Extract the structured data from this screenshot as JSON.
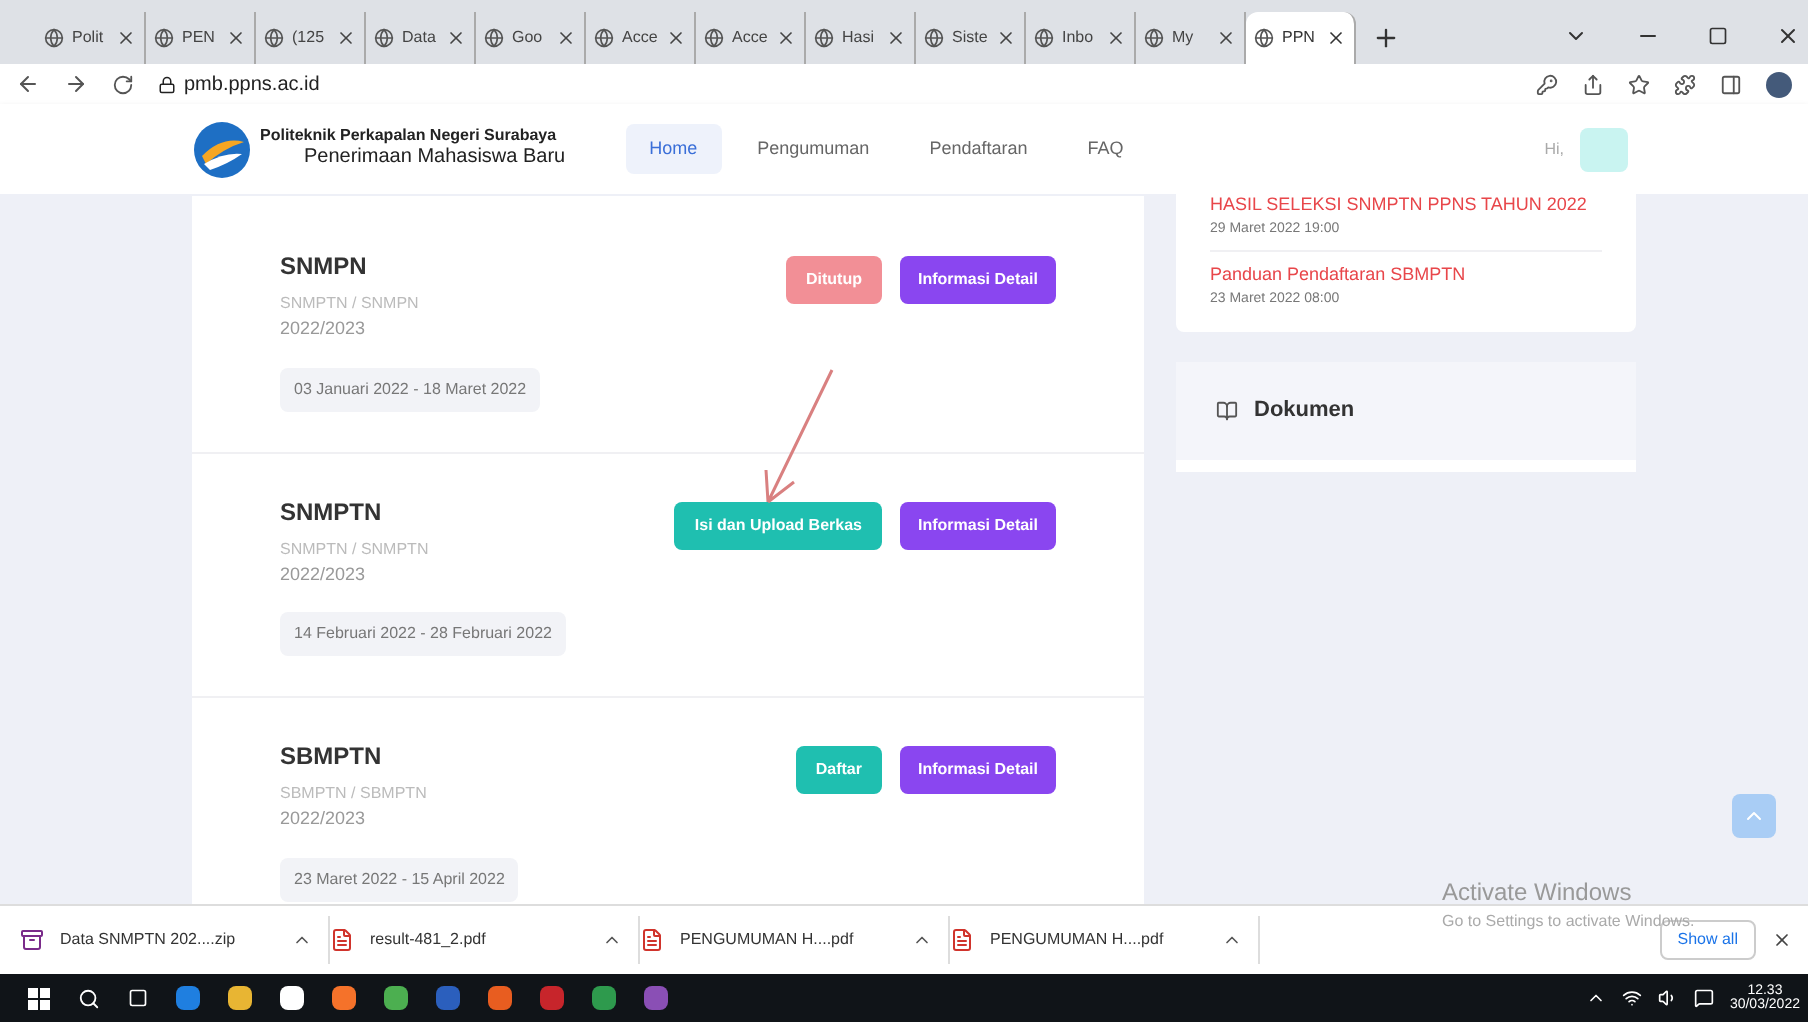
{
  "browser": {
    "tabs": [
      {
        "title": "Polit",
        "selected": false
      },
      {
        "title": "PEN",
        "selected": false
      },
      {
        "title": "(125",
        "selected": false
      },
      {
        "title": "Data",
        "selected": false
      },
      {
        "title": "Goo",
        "selected": false
      },
      {
        "title": "Acce",
        "selected": false
      },
      {
        "title": "Acce",
        "selected": false
      },
      {
        "title": "Hasi",
        "selected": false
      },
      {
        "title": "Siste",
        "selected": false
      },
      {
        "title": "Inbo",
        "selected": false
      },
      {
        "title": "My",
        "selected": false
      },
      {
        "title": "PPN",
        "selected": true
      }
    ],
    "url": "pmb.ppns.ac.id"
  },
  "header": {
    "brand_title": "Politeknik Perkapalan Negeri Surabaya",
    "brand_subtitle": "Penerimaan Mahasiswa Baru",
    "nav": [
      {
        "label": "Home",
        "selected": true
      },
      {
        "label": "Pengumuman",
        "selected": false
      },
      {
        "label": "Pendaftaran",
        "selected": false
      },
      {
        "label": "FAQ",
        "selected": false
      }
    ],
    "greeting": "Hi,"
  },
  "programs": [
    {
      "name": "SNMPN",
      "path": "SNMPTN / SNMPN",
      "year": "2022/2023",
      "period": "03 Januari 2022 - 18 Maret 2022",
      "action": {
        "label": "Ditutup",
        "kind": "closed"
      },
      "detail": "Informasi Detail"
    },
    {
      "name": "SNMPTN",
      "path": "SNMPTN / SNMPTN",
      "year": "2022/2023",
      "period": "14 Februari 2022 - 28 Februari 2022",
      "action": {
        "label": "Isi dan Upload Berkas",
        "kind": "open"
      },
      "detail": "Informasi Detail"
    },
    {
      "name": "SBMPTN",
      "path": "SBMPTN / SBMPTN",
      "year": "2022/2023",
      "period": "23 Maret 2022 - 15 April 2022",
      "action": {
        "label": "Daftar",
        "kind": "open"
      },
      "detail": "Informasi Detail"
    }
  ],
  "announcements": [
    {
      "title": "HASIL SELEKSI SNMPTN PPNS TAHUN 2022",
      "date": "29 Maret 2022 19:00"
    },
    {
      "title": "Panduan Pendaftaran SBMPTN",
      "date": "23 Maret 2022 08:00"
    }
  ],
  "documents": {
    "title": "Dokumen"
  },
  "watermark": {
    "title": "Activate Windows",
    "subtitle": "Go to Settings to activate Windows."
  },
  "downloads": {
    "items": [
      {
        "name": "Data SNMPTN 202....zip",
        "kind": "zip"
      },
      {
        "name": "result-481_2.pdf",
        "kind": "pdf"
      },
      {
        "name": "PENGUMUMAN H....pdf",
        "kind": "pdf"
      },
      {
        "name": "PENGUMUMAN H....pdf",
        "kind": "pdf"
      }
    ],
    "show_all": "Show all"
  },
  "taskbar": {
    "time": "12.33",
    "date": "30/03/2022"
  }
}
